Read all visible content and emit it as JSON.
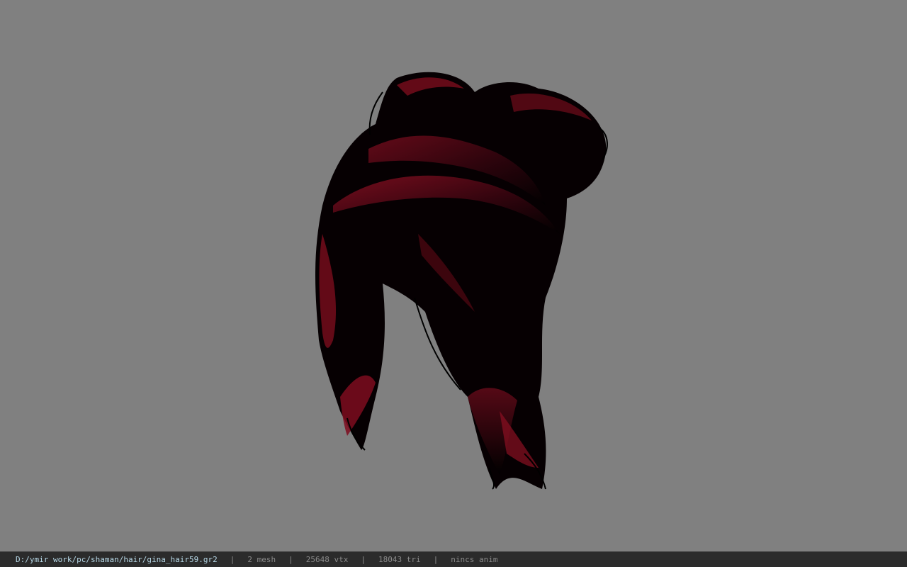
{
  "viewport": {
    "background_color": "#808080",
    "model": {
      "icon": "hair-model-icon",
      "hair_color": "#8b0f22",
      "shadow_color": "#000000"
    }
  },
  "status_bar": {
    "file_path": "D:/ymir work/pc/shaman/hair/gina_hair59.gr2",
    "separator": "|",
    "mesh_count": "2 mesh",
    "vertex_count": "25648 vtx",
    "triangle_count": "18043 tri",
    "anim_status": "nincs anim"
  }
}
